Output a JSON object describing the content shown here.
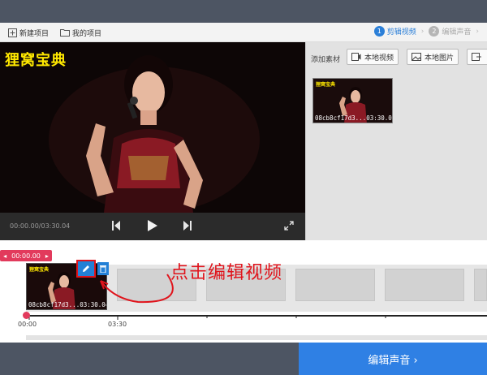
{
  "toolbar": {
    "new_project": "新建项目",
    "my_projects": "我的项目",
    "steps": [
      {
        "num": "1",
        "label": "剪辑视频"
      },
      {
        "num": "2",
        "label": "编辑声音"
      }
    ]
  },
  "player": {
    "overlay_title": "狸窝宝典",
    "timecode": "00:00.00/03:30.04"
  },
  "library": {
    "add_label": "添加素材",
    "local_video": "本地视频",
    "local_image": "本地图片",
    "thumb": {
      "title": "狸窝宝典",
      "name": "08cb8cf17d3...",
      "duration": "03:30.04"
    }
  },
  "timeline": {
    "current_time": "00:00.00",
    "clip": {
      "title": "狸窝宝典",
      "name": "08cb8cf17d3...",
      "duration": "03:30.04"
    },
    "annotation": "点击编辑视频",
    "ticks": [
      "00:00",
      "03:30"
    ]
  },
  "footer": {
    "next_label": "编辑声音 ›"
  },
  "colors": {
    "accent": "#2f80e4",
    "highlight": "#e0141c",
    "playhead": "#e23a5c",
    "chrome": "#4d5563"
  }
}
